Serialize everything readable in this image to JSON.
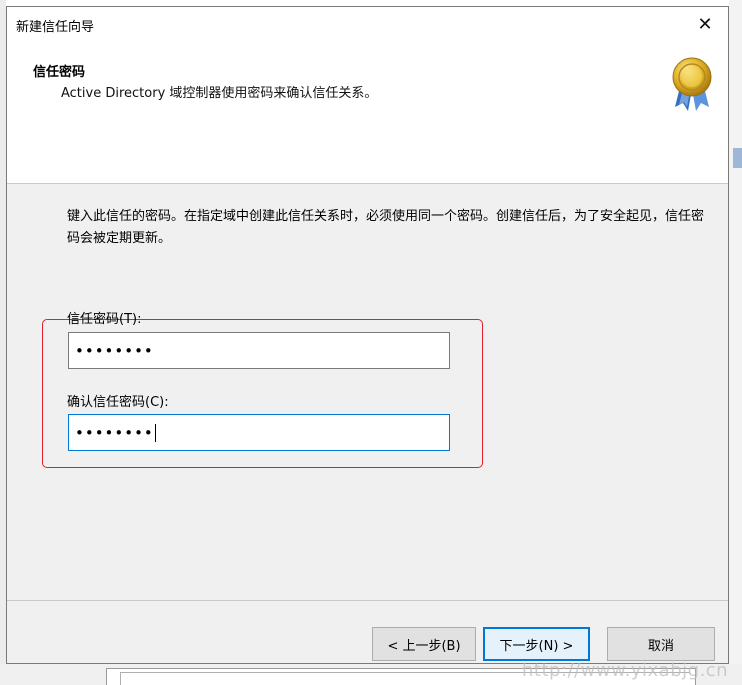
{
  "dialog": {
    "title": "新建信任向导",
    "close_glyph": "✕"
  },
  "header": {
    "title": "信任密码",
    "subtitle": "Active Directory 域控制器使用密码来确认信任关系。",
    "icon": "award-ribbon-icon"
  },
  "content": {
    "description": "键入此信任的密码。在指定域中创建此信任关系时，必须使用同一个密码。创建信任后，为了安全起见，信任密码会被定期更新。",
    "trust_password_label": "信任密码(T):",
    "trust_password_value": "••••••••",
    "confirm_password_label": "确认信任密码(C):",
    "confirm_password_value": "••••••••"
  },
  "buttons": {
    "back": "< 上一步(B)",
    "next": "下一步(N) >",
    "cancel": "取消"
  },
  "background": {
    "watermark": "http://www.yixabjg.cn"
  },
  "colors": {
    "highlight": "#e0202a",
    "focus": "#0078d7"
  }
}
